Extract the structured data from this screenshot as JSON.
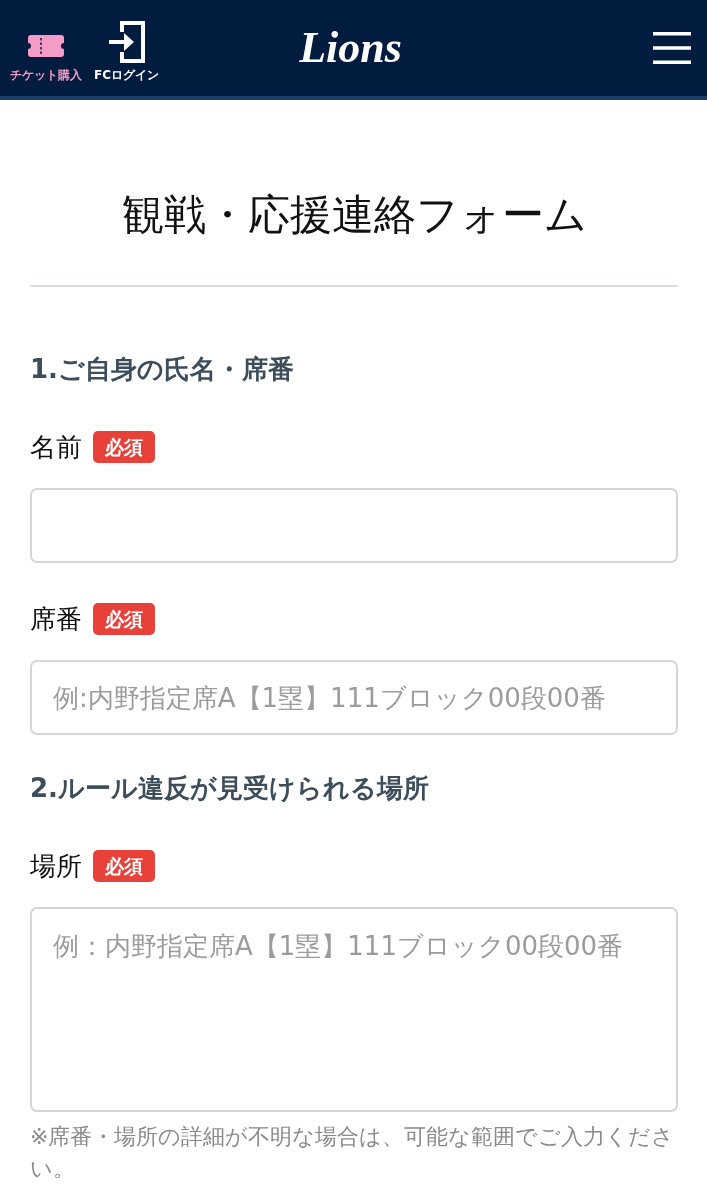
{
  "header": {
    "actions": [
      {
        "kind": "ticket",
        "label": "チケット購入"
      },
      {
        "kind": "login",
        "label": "FCログイン"
      }
    ],
    "logo": "Lions"
  },
  "form": {
    "title": "観戦・応援連絡フォーム",
    "sections": [
      {
        "heading": "1.ご自身の氏名・席番",
        "fields": [
          {
            "kind": "input",
            "label": "名前",
            "badge": "必須"
          },
          {
            "kind": "input",
            "label": "席番",
            "badge": "必須",
            "placeholder": "例:内野指定席A【1塁】111ブロック00段00番"
          }
        ]
      },
      {
        "heading": "2.ルール違反が見受けられる場所",
        "fields": [
          {
            "kind": "textarea",
            "label": "場所",
            "badge": "必須",
            "placeholder": "例：内野指定席A【1塁】111ブロック00段00番",
            "note": "※席番・場所の詳細が不明な場合は、可能な範囲でご入力ください。"
          }
        ]
      }
    ]
  }
}
